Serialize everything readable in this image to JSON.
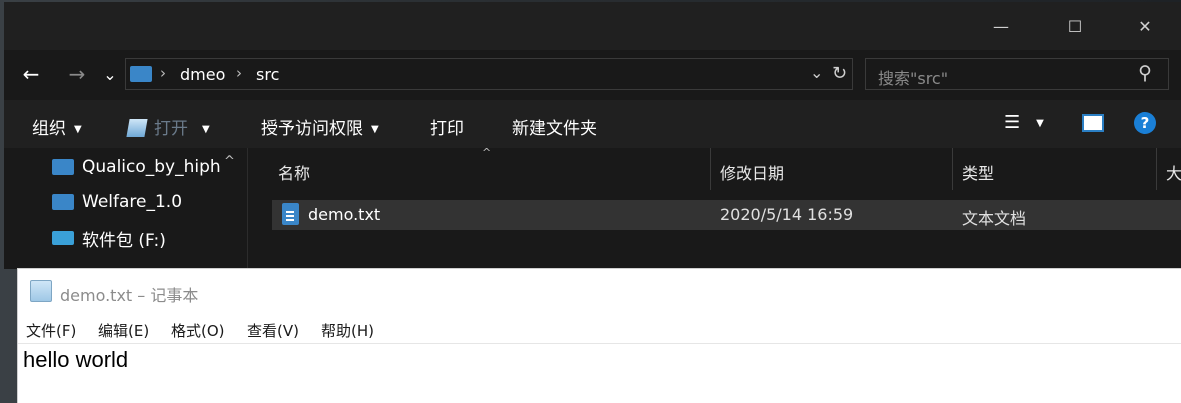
{
  "explorer": {
    "window_controls": {
      "minimize": "—",
      "maximize": "☐",
      "close": "✕"
    },
    "nav": {
      "back": "←",
      "forward": "→",
      "recent": "⌄",
      "address_dropdown": "⌄",
      "refresh": "↻"
    },
    "breadcrumb": [
      "dmeo",
      "src"
    ],
    "breadcrumb_sep": "›",
    "search_placeholder": "搜索\"src\"",
    "search_icon": "⚲",
    "toolbar": {
      "organize": "组织",
      "open": "打开",
      "grant_access": "授予访问权限",
      "print": "打印",
      "new_folder": "新建文件夹",
      "view_icon": "☰",
      "preview_icon": "◧",
      "help": "?"
    },
    "nav_pane": [
      {
        "label": "Qualico_by_hiph",
        "icon": "folder-icon"
      },
      {
        "label": "Welfare_1.0",
        "icon": "folder-icon"
      },
      {
        "label": "软件包 (F:)",
        "icon": "drive-icon"
      }
    ],
    "scroll_up": "^",
    "columns": {
      "name": "名称",
      "modified": "修改日期",
      "type": "类型",
      "size": "大"
    },
    "sort_indicator": "^",
    "files": [
      {
        "name": "demo.txt",
        "modified": "2020/5/14 16:59",
        "type": "文本文档"
      }
    ],
    "accent_color": "#3a86c8"
  },
  "notepad": {
    "title": "demo.txt – 记事本",
    "menu": [
      "文件(F)",
      "编辑(E)",
      "格式(O)",
      "查看(V)",
      "帮助(H)"
    ],
    "content": "hello world"
  }
}
